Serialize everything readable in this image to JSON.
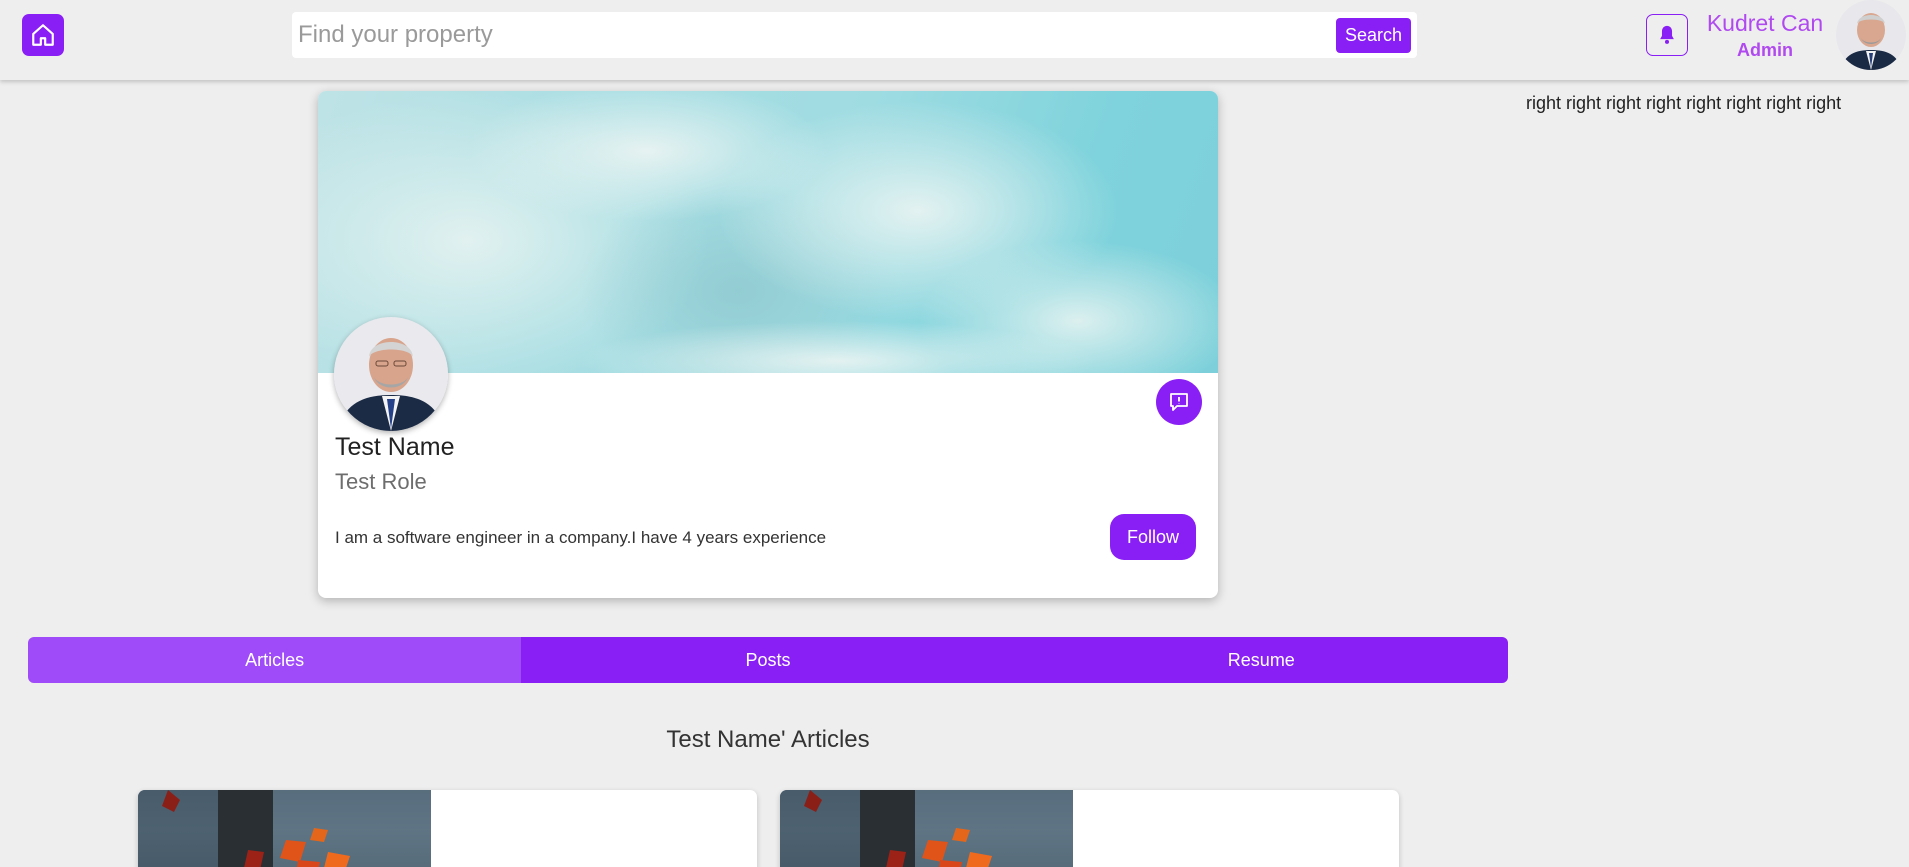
{
  "header": {
    "search_placeholder": "Find your property",
    "search_button": "Search",
    "user_name": "Kudret Can",
    "user_role": "Admin",
    "icons": [
      "home-icon",
      "bell-icon"
    ]
  },
  "sidebar_right": {
    "text": "right right right right right right right right"
  },
  "profile": {
    "name": "Test Name",
    "role": "Test Role",
    "bio": "I am a software engineer in a company.I have 4 years experience",
    "follow_label": "Follow",
    "report_icon": "report-icon"
  },
  "tabs": [
    {
      "label": "Articles",
      "active": true
    },
    {
      "label": "Posts",
      "active": false
    },
    {
      "label": "Resume",
      "active": false
    }
  ],
  "articles_section": {
    "title": "Test Name' Articles"
  },
  "colors": {
    "accent": "#8a1ff5",
    "accent_light": "#a04bfa",
    "user_text": "#b04af0",
    "background": "#eeeeee"
  }
}
